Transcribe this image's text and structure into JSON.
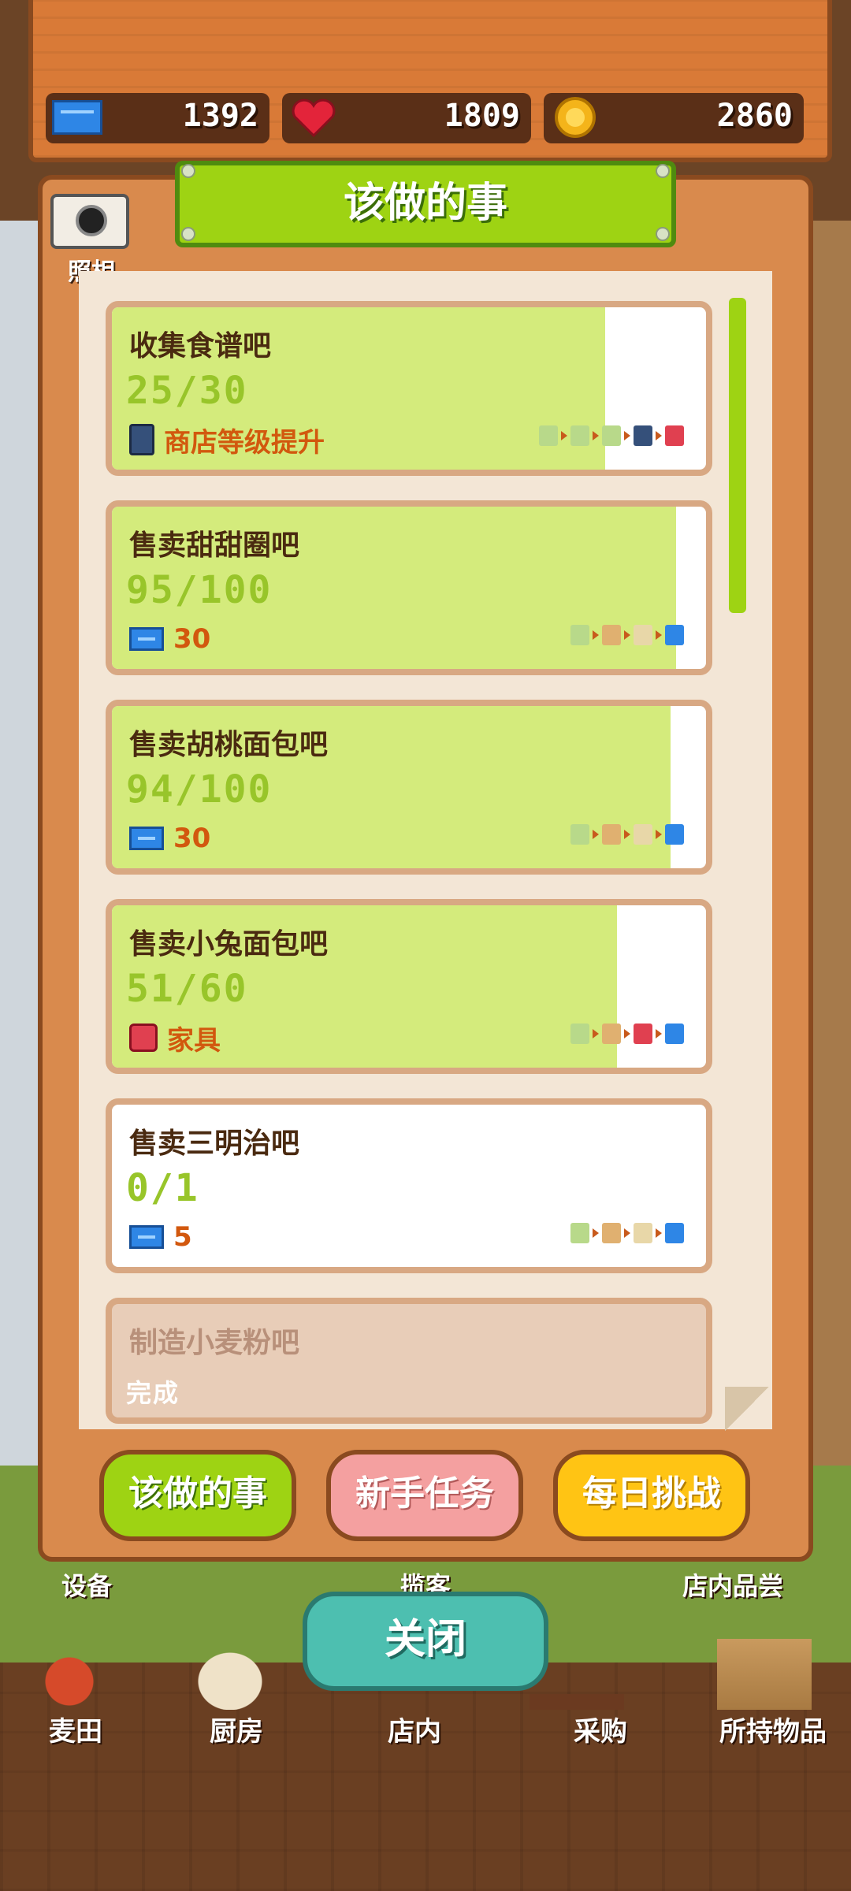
{
  "stats": {
    "tickets": "1392",
    "hearts": "1809",
    "coins": "2860"
  },
  "panel": {
    "title": "该做的事",
    "camera_label": "照相"
  },
  "quests": [
    {
      "name": "收集食谱吧",
      "progress": "25/30",
      "fraction": 0.83,
      "reward": "商店等级提升",
      "reward_icon": "shop-building-icon",
      "done": false
    },
    {
      "name": "售卖甜甜圈吧",
      "progress": "95/100",
      "fraction": 0.95,
      "reward": "30",
      "reward_icon": "ticket-icon",
      "done": false
    },
    {
      "name": "售卖胡桃面包吧",
      "progress": "94/100",
      "fraction": 0.94,
      "reward": "30",
      "reward_icon": "ticket-icon",
      "done": false
    },
    {
      "name": "售卖小兔面包吧",
      "progress": "51/60",
      "fraction": 0.85,
      "reward": "家具",
      "reward_icon": "gift-icon",
      "done": false
    },
    {
      "name": "售卖三明治吧",
      "progress": "0/1",
      "fraction": 0.0,
      "reward": "5",
      "reward_icon": "ticket-icon",
      "done": false
    },
    {
      "name": "制造小麦粉吧",
      "progress": "完成",
      "fraction": 1.0,
      "reward": "",
      "reward_icon": "coin-icon",
      "done": true
    }
  ],
  "tabs": {
    "todo": "该做的事",
    "beginner": "新手任务",
    "daily": "每日挑战"
  },
  "close_label": "关闭",
  "background_labels": {
    "equipment": "设备",
    "customer": "揽客",
    "tasting": "店内品尝"
  },
  "nav": {
    "wheat": "麦田",
    "kitchen": "厨房",
    "store": "店内",
    "purchase": "采购",
    "items": "所持物品"
  },
  "colors": {
    "accent_green": "#9ed313",
    "progress_fill": "#d4eb7c",
    "progress_text": "#98c52a",
    "reward_text": "#d2580e",
    "tab_pink": "#f4a0a0",
    "tab_yellow": "#ffc414",
    "close_teal": "#4dbfb0"
  }
}
